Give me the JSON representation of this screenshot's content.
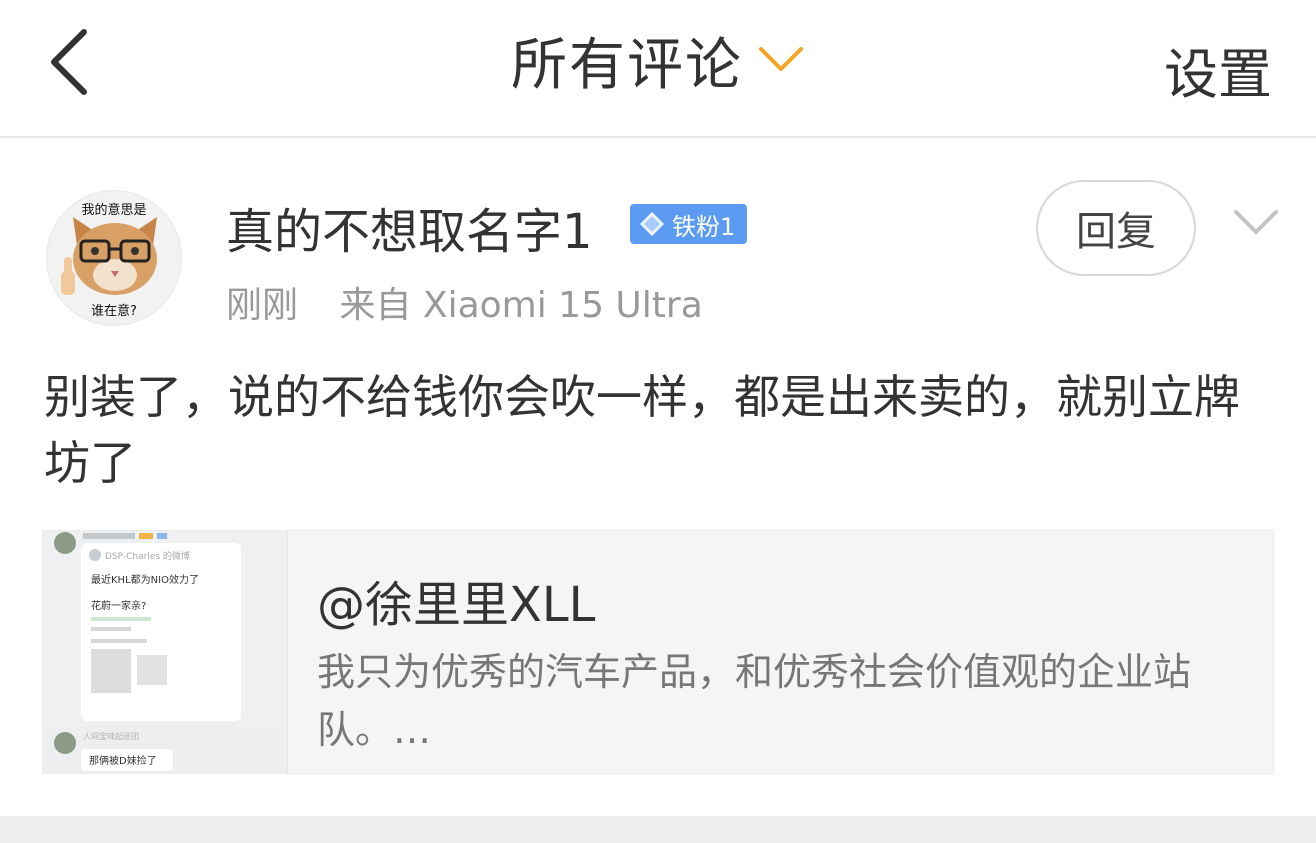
{
  "header": {
    "title": "所有评论",
    "settings_label": "设置"
  },
  "comment": {
    "avatar": {
      "top_text": "我的意思是",
      "bottom_text": "谁在意?"
    },
    "username": "真的不想取名字1",
    "badge": "铁粉1",
    "time": "刚刚",
    "source": "来自 Xiaomi 15 Ultra",
    "reply_label": "回复",
    "text": "别装了，说的不给钱你会吹一样，都是出来卖的，就别立牌坊了"
  },
  "linked_post": {
    "author": "@徐里里XLL",
    "description": "我只为优秀的汽车产品，和优秀社会价值观的企业站队。…",
    "thumbnail": {
      "header_name": "人间宝味起送团",
      "inner_user": "DSP-Charles 的微博",
      "line1": "最近KHL都为NIO效力了",
      "line2": "花蔚一家亲?",
      "bottom_text": "那俩被D妹捡了"
    }
  },
  "colors": {
    "accent_orange": "#f5a623",
    "badge_blue": "#5b9cf2",
    "text_primary": "#333333",
    "text_secondary": "#999999"
  },
  "icons": {
    "back": "chevron-left-icon",
    "title_dropdown": "chevron-down-icon",
    "more": "chevron-down-icon",
    "badge": "diamond-icon"
  }
}
